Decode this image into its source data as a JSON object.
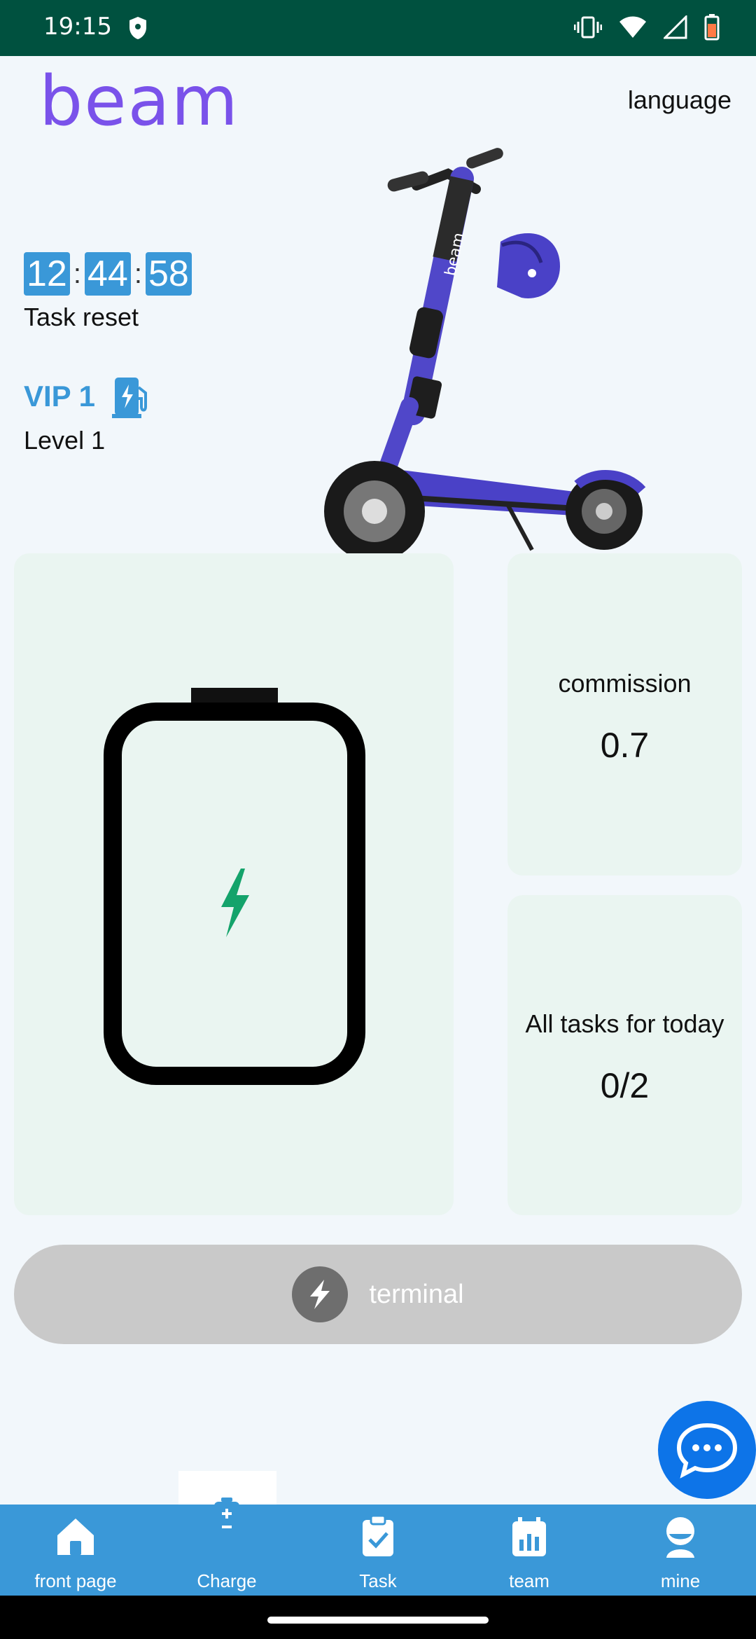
{
  "status": {
    "time": "19:15"
  },
  "header": {
    "brand": "beam",
    "language": "language"
  },
  "timer": {
    "hours": "12",
    "minutes": "44",
    "seconds": "58",
    "separator": ":",
    "caption": "Task reset"
  },
  "vip": {
    "label": "VIP 1",
    "level": "Level 1"
  },
  "stats": {
    "commission_label": "commission",
    "commission_value": "0.7",
    "tasks_label": "All tasks for today",
    "tasks_value": "0/2"
  },
  "terminal": {
    "label": "terminal"
  },
  "nav": {
    "items": [
      {
        "label": "front page",
        "icon": "home-icon"
      },
      {
        "label": "Charge",
        "icon": "battery-icon",
        "active": true
      },
      {
        "label": "Task",
        "icon": "clipboard-check-icon"
      },
      {
        "label": "team",
        "icon": "calendar-chart-icon"
      },
      {
        "label": "mine",
        "icon": "person-icon"
      }
    ]
  },
  "colors": {
    "accent": "#3a98d8",
    "status_bar": "#00513f",
    "panel": "#eaf5f1",
    "chat": "#0d74e8",
    "bolt": "#14a36b"
  }
}
